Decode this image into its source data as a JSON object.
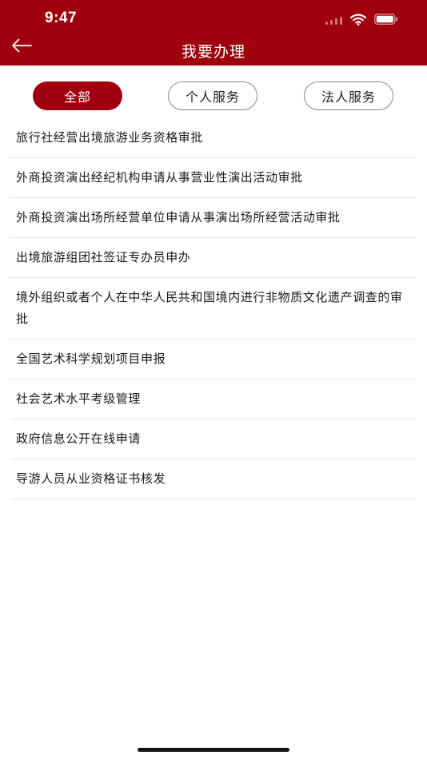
{
  "status_bar": {
    "time": "9:47"
  },
  "header": {
    "title": "我要办理",
    "back_icon": "arrow-left-icon",
    "background_color": "#a0000e"
  },
  "tabs": [
    {
      "label": "全部",
      "active": true
    },
    {
      "label": "个人服务",
      "active": false
    },
    {
      "label": "法人服务",
      "active": false
    }
  ],
  "list": {
    "items": [
      {
        "label": "旅行社经营出境旅游业务资格审批"
      },
      {
        "label": "外商投资演出经纪机构申请从事营业性演出活动审批"
      },
      {
        "label": "外商投资演出场所经营单位申请从事演出场所经营活动审批"
      },
      {
        "label": "出境旅游组团社签证专办员申办"
      },
      {
        "label": "境外组织或者个人在中华人民共和国境内进行非物质文化遗产调查的审批"
      },
      {
        "label": "全国艺术科学规划项目申报"
      },
      {
        "label": "社会艺术水平考级管理"
      },
      {
        "label": "政府信息公开在线申请"
      },
      {
        "label": "导游人员从业资格证书核发"
      }
    ]
  }
}
